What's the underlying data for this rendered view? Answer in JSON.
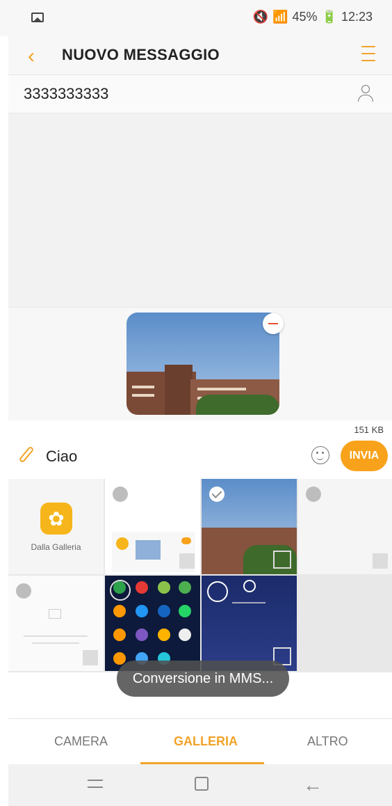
{
  "status_bar": {
    "battery": "45%",
    "time": "12:23"
  },
  "header": {
    "title": "NUOVO MESSAGGIO"
  },
  "recipient": {
    "number": "3333333333"
  },
  "attachment": {
    "size": "151 KB"
  },
  "composer": {
    "text": "Ciao",
    "send_label": "INVIA"
  },
  "gallery": {
    "from_gallery_label": "Dalla Galleria",
    "items": [
      {
        "selected": false
      },
      {
        "selected": true
      },
      {
        "selected": false
      },
      {
        "selected": false
      },
      {
        "selected": false
      },
      {
        "selected": false
      }
    ]
  },
  "toast": {
    "text": "Conversione in MMS..."
  },
  "tabs": [
    {
      "label": "CAMERA",
      "active": false
    },
    {
      "label": "GALLERIA",
      "active": true
    },
    {
      "label": "ALTRO",
      "active": false
    }
  ],
  "colors": {
    "accent": "#f2a32a",
    "send_button": "#f8a21b"
  }
}
